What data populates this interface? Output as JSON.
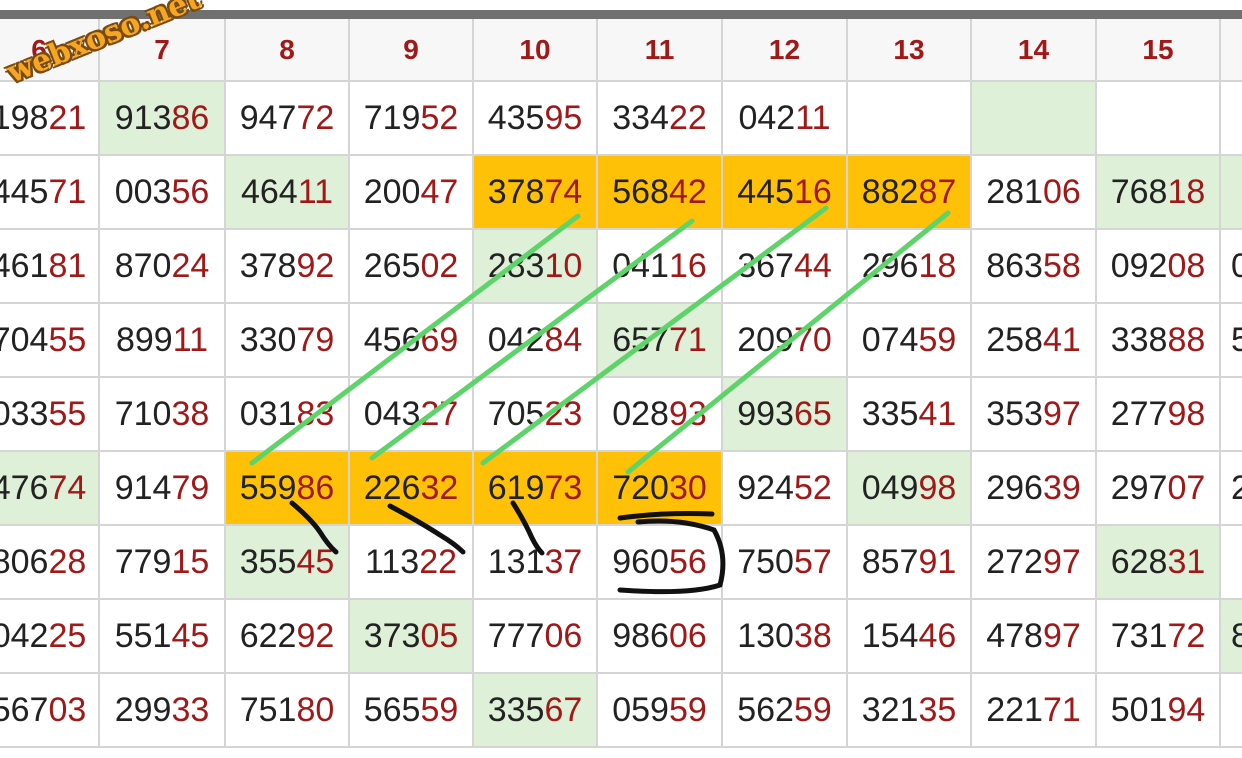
{
  "watermark": "webxoso.net",
  "colors": {
    "highlight": "#ffc107",
    "green_cell": "#dff0d8",
    "red_digits": "#a11818",
    "line": "#5ed36a",
    "marker": "#111111"
  },
  "columns": [
    "6",
    "7",
    "8",
    "9",
    "10",
    "11",
    "12",
    "13",
    "14",
    "15",
    ""
  ],
  "rows": [
    [
      {
        "v": "19821",
        "g": false
      },
      {
        "v": "91386",
        "g": true
      },
      {
        "v": "94772",
        "g": false
      },
      {
        "v": "71952",
        "g": false
      },
      {
        "v": "43595",
        "g": false
      },
      {
        "v": "33422",
        "g": false
      },
      {
        "v": "04211",
        "g": false
      },
      {
        "v": "",
        "g": false
      },
      {
        "v": "",
        "g": true
      },
      {
        "v": "",
        "g": false
      },
      {
        "v": "",
        "g": false
      }
    ],
    [
      {
        "v": "44571",
        "g": false
      },
      {
        "v": "00356",
        "g": false
      },
      {
        "v": "46411",
        "g": true
      },
      {
        "v": "20047",
        "g": false
      },
      {
        "v": "37874",
        "o": true
      },
      {
        "v": "56842",
        "o": true
      },
      {
        "v": "44516",
        "o": true
      },
      {
        "v": "88287",
        "o": true
      },
      {
        "v": "28106",
        "g": false
      },
      {
        "v": "76818",
        "g": true
      },
      {
        "v": "",
        "g": true
      }
    ],
    [
      {
        "v": "46181",
        "g": false
      },
      {
        "v": "87024",
        "g": false
      },
      {
        "v": "37892",
        "g": false
      },
      {
        "v": "26502",
        "g": false
      },
      {
        "v": "28310",
        "g": true
      },
      {
        "v": "04116",
        "g": false
      },
      {
        "v": "36744",
        "g": false
      },
      {
        "v": "29618",
        "g": false
      },
      {
        "v": "86358",
        "g": false
      },
      {
        "v": "09208",
        "g": false
      },
      {
        "v": "0",
        "g": false
      }
    ],
    [
      {
        "v": "70455",
        "g": false
      },
      {
        "v": "89911",
        "g": false
      },
      {
        "v": "33079",
        "g": false
      },
      {
        "v": "45669",
        "g": false
      },
      {
        "v": "04284",
        "g": false
      },
      {
        "v": "65771",
        "g": true
      },
      {
        "v": "20970",
        "g": false
      },
      {
        "v": "07459",
        "g": false
      },
      {
        "v": "25841",
        "g": false
      },
      {
        "v": "33888",
        "g": false
      },
      {
        "v": "5",
        "g": false
      }
    ],
    [
      {
        "v": "03355",
        "g": false
      },
      {
        "v": "71038",
        "g": false
      },
      {
        "v": "03183",
        "g": false
      },
      {
        "v": "04327",
        "g": false
      },
      {
        "v": "70523",
        "g": false
      },
      {
        "v": "02893",
        "g": false
      },
      {
        "v": "99365",
        "g": true
      },
      {
        "v": "33541",
        "g": false
      },
      {
        "v": "35397",
        "g": false
      },
      {
        "v": "27798",
        "g": false
      },
      {
        "v": "",
        "g": false
      }
    ],
    [
      {
        "v": "47674",
        "g": true
      },
      {
        "v": "91479",
        "g": false
      },
      {
        "v": "55986",
        "o": true
      },
      {
        "v": "22632",
        "o": true
      },
      {
        "v": "61973",
        "o": true
      },
      {
        "v": "72030",
        "o": true
      },
      {
        "v": "92452",
        "g": false
      },
      {
        "v": "04998",
        "g": true
      },
      {
        "v": "29639",
        "g": false
      },
      {
        "v": "29707",
        "g": false
      },
      {
        "v": "2",
        "g": false
      }
    ],
    [
      {
        "v": "80628",
        "g": false
      },
      {
        "v": "77915",
        "g": false
      },
      {
        "v": "35545",
        "g": true
      },
      {
        "v": "11322",
        "g": false
      },
      {
        "v": "13137",
        "g": false
      },
      {
        "v": "96056",
        "g": false
      },
      {
        "v": "75057",
        "g": false
      },
      {
        "v": "85791",
        "g": false
      },
      {
        "v": "27297",
        "g": false
      },
      {
        "v": "62831",
        "g": true
      },
      {
        "v": "",
        "g": false
      }
    ],
    [
      {
        "v": "04225",
        "g": false
      },
      {
        "v": "55145",
        "g": false
      },
      {
        "v": "62292",
        "g": false
      },
      {
        "v": "37305",
        "g": true
      },
      {
        "v": "77706",
        "g": false
      },
      {
        "v": "98606",
        "g": false
      },
      {
        "v": "13038",
        "g": false
      },
      {
        "v": "15446",
        "g": false
      },
      {
        "v": "47897",
        "g": false
      },
      {
        "v": "73172",
        "g": false
      },
      {
        "v": "8",
        "g": true
      }
    ],
    [
      {
        "v": "56703",
        "g": false
      },
      {
        "v": "29933",
        "g": false
      },
      {
        "v": "75180",
        "g": false
      },
      {
        "v": "56559",
        "g": false
      },
      {
        "v": "33567",
        "g": true
      },
      {
        "v": "05959",
        "g": false
      },
      {
        "v": "56259",
        "g": false
      },
      {
        "v": "32135",
        "g": false
      },
      {
        "v": "22171",
        "g": false
      },
      {
        "v": "50194",
        "g": false
      },
      {
        "v": "",
        "g": false
      }
    ]
  ]
}
